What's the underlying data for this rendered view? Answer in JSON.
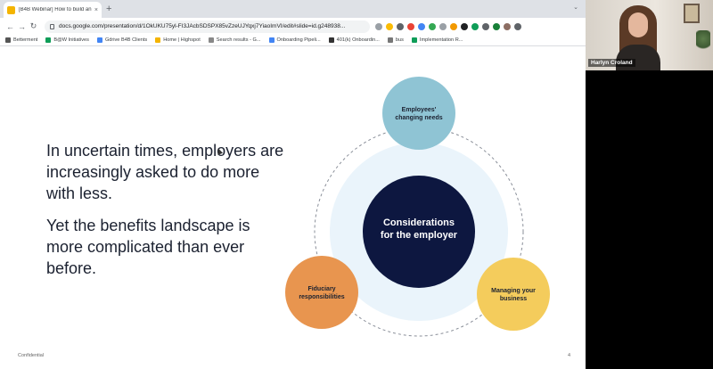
{
  "browser": {
    "tab_title": "[B4B Webinar] How to build an",
    "tab_close": "×",
    "new_tab": "+",
    "window_controls": "⌄",
    "url": "docs.google.com/presentation/d/1OkUKU75yl-FI3JAcbSDSPX85vZzeUJYqxj7YiaoImVI/edit#slide=id.g248938...",
    "nav": {
      "back": "←",
      "forward": "→",
      "reload": "↻"
    },
    "bookmarks": [
      {
        "label": "Betterment",
        "color": "#555555"
      },
      {
        "label": "B@W Initiatives",
        "color": "#0f9d58"
      },
      {
        "label": "Gdrive B4B Clients",
        "color": "#4285f4"
      },
      {
        "label": "Home | Highspot",
        "color": "#f4b400"
      },
      {
        "label": "Search results - G...",
        "color": "#888888"
      },
      {
        "label": "Onboarding Pipeli...",
        "color": "#4285f4"
      },
      {
        "label": "401(k) Onboardin...",
        "color": "#333333"
      },
      {
        "label": "bus",
        "color": "#777777"
      },
      {
        "label": "Implementation R...",
        "color": "#0f9d58"
      }
    ]
  },
  "slide": {
    "paragraph1": "In uncertain times, employers are increasingly asked to do more with less.",
    "paragraph2": "Yet the benefits landscape is more complicated than ever before.",
    "footer_left": "Confidential",
    "page_number": "4"
  },
  "diagram": {
    "center": {
      "line1": "Considerations",
      "line2": "for the employer",
      "color": "#0d1740"
    },
    "top": {
      "line1": "Employees'",
      "line2": "changing needs",
      "color": "#8fc4d4"
    },
    "left": {
      "line1": "Fiduciary",
      "line2": "responsibilities",
      "color": "#e8954f"
    },
    "right": {
      "line1": "Managing your",
      "line2": "business",
      "color": "#f4cc5c"
    },
    "halo_color": "#eaf4fb"
  },
  "video": {
    "name": "Harlyn Croland"
  }
}
